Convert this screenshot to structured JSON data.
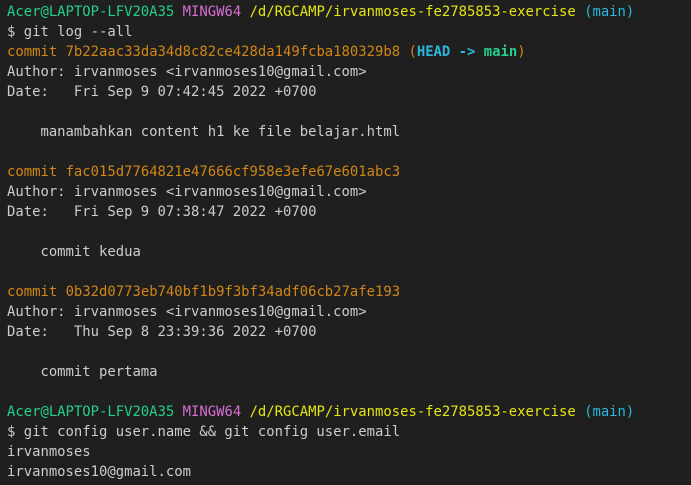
{
  "prompt_1": {
    "user_host": "Acer@LAPTOP-LFV20A35",
    "env": "MINGW64",
    "path": "/d/RGCAMP/irvanmoses-fe2785853-exercise",
    "branch": "(main)"
  },
  "command_1": "$ git log --all",
  "commits": [
    {
      "label": "commit",
      "hash": "7b22aac33da34d8c82ce428da149fcba180329b8",
      "ref_open": "(",
      "ref_head": "HEAD",
      "ref_arrow": "->",
      "ref_branch": "main",
      "ref_close": ")",
      "author": "Author: irvanmoses <irvanmoses10@gmail.com>",
      "date": "Date:   Fri Sep 9 07:42:45 2022 +0700",
      "message": "    manambahkan content h1 ke file belajar.html"
    },
    {
      "label": "commit",
      "hash": "fac015d7764821e47666cf958e3efe67e601abc3",
      "author": "Author: irvanmoses <irvanmoses10@gmail.com>",
      "date": "Date:   Fri Sep 9 07:38:47 2022 +0700",
      "message": "    commit kedua"
    },
    {
      "label": "commit",
      "hash": "0b32d0773eb740bf1b9f3bf34adf06cb27afe193",
      "author": "Author: irvanmoses <irvanmoses10@gmail.com>",
      "date": "Date:   Thu Sep 8 23:39:36 2022 +0700",
      "message": "    commit pertama"
    }
  ],
  "prompt_2": {
    "user_host": "Acer@LAPTOP-LFV20A35",
    "env": "MINGW64",
    "path": "/d/RGCAMP/irvanmoses-fe2785853-exercise",
    "branch": "(main)"
  },
  "command_2": "$ git config user.name && git config user.email",
  "output": [
    "irvanmoses",
    "irvanmoses10@gmail.com"
  ],
  "colors": {
    "background": "#1f1f1f",
    "text": "#cccccc",
    "green": "#23d18b",
    "magenta": "#d670d6",
    "yellow": "#e5e510",
    "cyan": "#29b8db",
    "commit_orange": "#d18616"
  }
}
